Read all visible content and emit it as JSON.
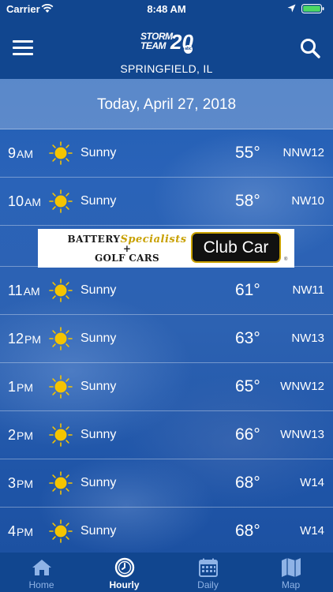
{
  "status_bar": {
    "carrier": "Carrier",
    "time": "8:48 AM"
  },
  "header": {
    "logo_text_1": "STORM",
    "logo_text_2": "TEAM",
    "logo_number": "20",
    "logo_network": "abc",
    "location": "SPRINGFIELD, IL"
  },
  "date_label": "Today, April 27, 2018",
  "hours": [
    {
      "hour": "9",
      "ampm": "AM",
      "icon": "sun-icon",
      "condition": "Sunny",
      "temp": "55°",
      "wind": "NNW12"
    },
    {
      "hour": "10",
      "ampm": "AM",
      "icon": "sun-icon",
      "condition": "Sunny",
      "temp": "58°",
      "wind": "NW10"
    },
    {
      "hour": "11",
      "ampm": "AM",
      "icon": "sun-icon",
      "condition": "Sunny",
      "temp": "61°",
      "wind": "NW11"
    },
    {
      "hour": "12",
      "ampm": "PM",
      "icon": "sun-icon",
      "condition": "Sunny",
      "temp": "63°",
      "wind": "NW13"
    },
    {
      "hour": "1",
      "ampm": "PM",
      "icon": "sun-icon",
      "condition": "Sunny",
      "temp": "65°",
      "wind": "WNW12"
    },
    {
      "hour": "2",
      "ampm": "PM",
      "icon": "sun-icon",
      "condition": "Sunny",
      "temp": "66°",
      "wind": "WNW13"
    },
    {
      "hour": "3",
      "ampm": "PM",
      "icon": "sun-icon",
      "condition": "Sunny",
      "temp": "68°",
      "wind": "W14"
    },
    {
      "hour": "4",
      "ampm": "PM",
      "icon": "sun-icon",
      "condition": "Sunny",
      "temp": "68°",
      "wind": "W14"
    }
  ],
  "ad": {
    "line1_a": "BATTERY",
    "line1_b": "Specialists",
    "line2": "+",
    "line3": "GOLF CARS",
    "brand": "Club Car",
    "trademark": "®"
  },
  "tabs": [
    {
      "label": "Home",
      "icon": "home-icon",
      "active": false
    },
    {
      "label": "Hourly",
      "icon": "clock-icon",
      "active": true
    },
    {
      "label": "Daily",
      "icon": "calendar-icon",
      "active": false
    },
    {
      "label": "Map",
      "icon": "map-icon",
      "active": false
    }
  ],
  "colors": {
    "bar": "#11468f",
    "active_tab": "#ffffff",
    "inactive_tab": "#8fb3e6",
    "sun": "#f5c400"
  }
}
